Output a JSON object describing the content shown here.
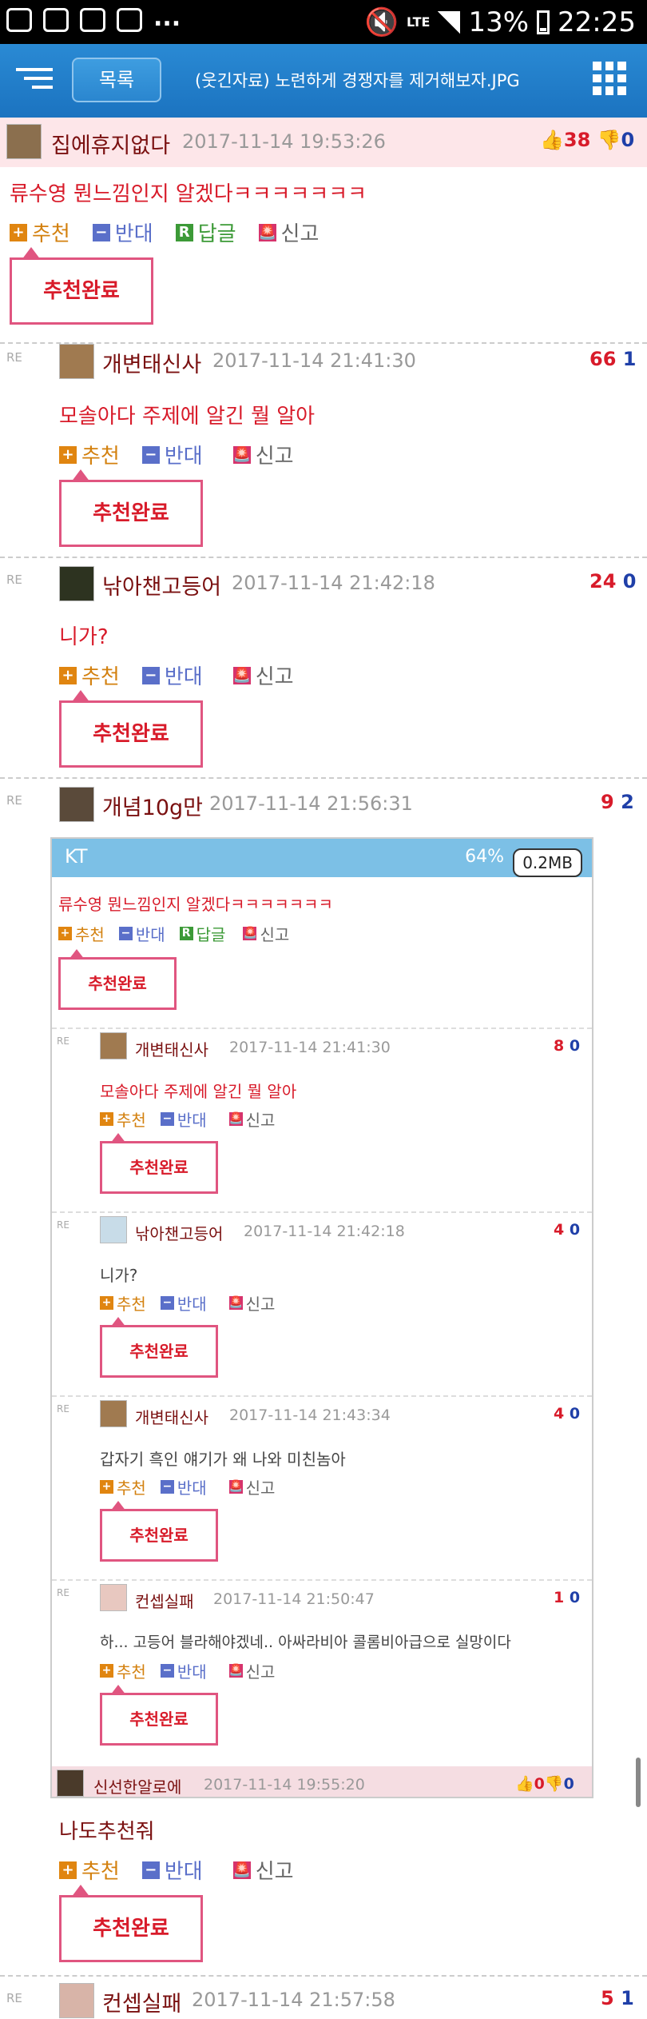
{
  "status_bar": {
    "battery": "13%",
    "time": "22:25",
    "network": "LTE",
    "dots": "..."
  },
  "top_bar": {
    "list_label": "목록",
    "title": "(웃긴자료) 노련하게 경쟁자를 제거해보자.JPG"
  },
  "post": {
    "author": "집에휴지없다",
    "date": "2017-11-14 19:53:26",
    "up": "38",
    "down": "0",
    "message": "류수영 뭔느낌인지 알겠다ㅋㅋㅋㅋㅋㅋㅋ"
  },
  "actions": {
    "recommend": "추천",
    "oppose": "반대",
    "reply": "답글",
    "report": "신고",
    "done": "추천완료",
    "reply_mark": "RE"
  },
  "comments": [
    {
      "author": "개변태신사",
      "date": "2017-11-14 21:41:30",
      "up": "66",
      "down": "1",
      "message": "모솔아다 주제에 알긴 뭘 알아"
    },
    {
      "author": "낚아챈고등어",
      "date": "2017-11-14 21:42:18",
      "up": "24",
      "down": "0",
      "message": "니가?"
    },
    {
      "author": "개념10g만",
      "date": "2017-11-14 21:56:31",
      "up": "9",
      "down": "2",
      "message": "나도추천줘"
    },
    {
      "author": "컨셉실패",
      "date": "2017-11-14 21:57:58",
      "up": "5",
      "down": "1"
    }
  ],
  "screenshot": {
    "carrier": "KT",
    "status": "64%",
    "size_badge": "0.2MB",
    "post_message": "류수영 뭔느낌인지 알겠다ㅋㅋㅋㅋㅋㅋㅋ",
    "comments": [
      {
        "author": "개변태신사",
        "date": "2017-11-14 21:41:30",
        "up": "8",
        "down": "0",
        "message": "모솔아다 주제에 알긴 뭘 알아"
      },
      {
        "author": "낚아챈고등어",
        "date": "2017-11-14 21:42:18",
        "up": "4",
        "down": "0",
        "message": "니가?"
      },
      {
        "author": "개변태신사",
        "date": "2017-11-14 21:43:34",
        "up": "4",
        "down": "0",
        "message": "갑자기 흑인 얘기가 왜 나와 미친놈아"
      },
      {
        "author": "컨셉실패",
        "date": "2017-11-14 21:50:47",
        "up": "1",
        "down": "0",
        "message": "하... 고등어 블라해야겠네.. 아싸라비아 콜롬비아급으로 실망이다"
      }
    ],
    "next_post": {
      "author": "신선한알로에",
      "date": "2017-11-14 19:55:20",
      "up": "0",
      "down": "0"
    }
  }
}
